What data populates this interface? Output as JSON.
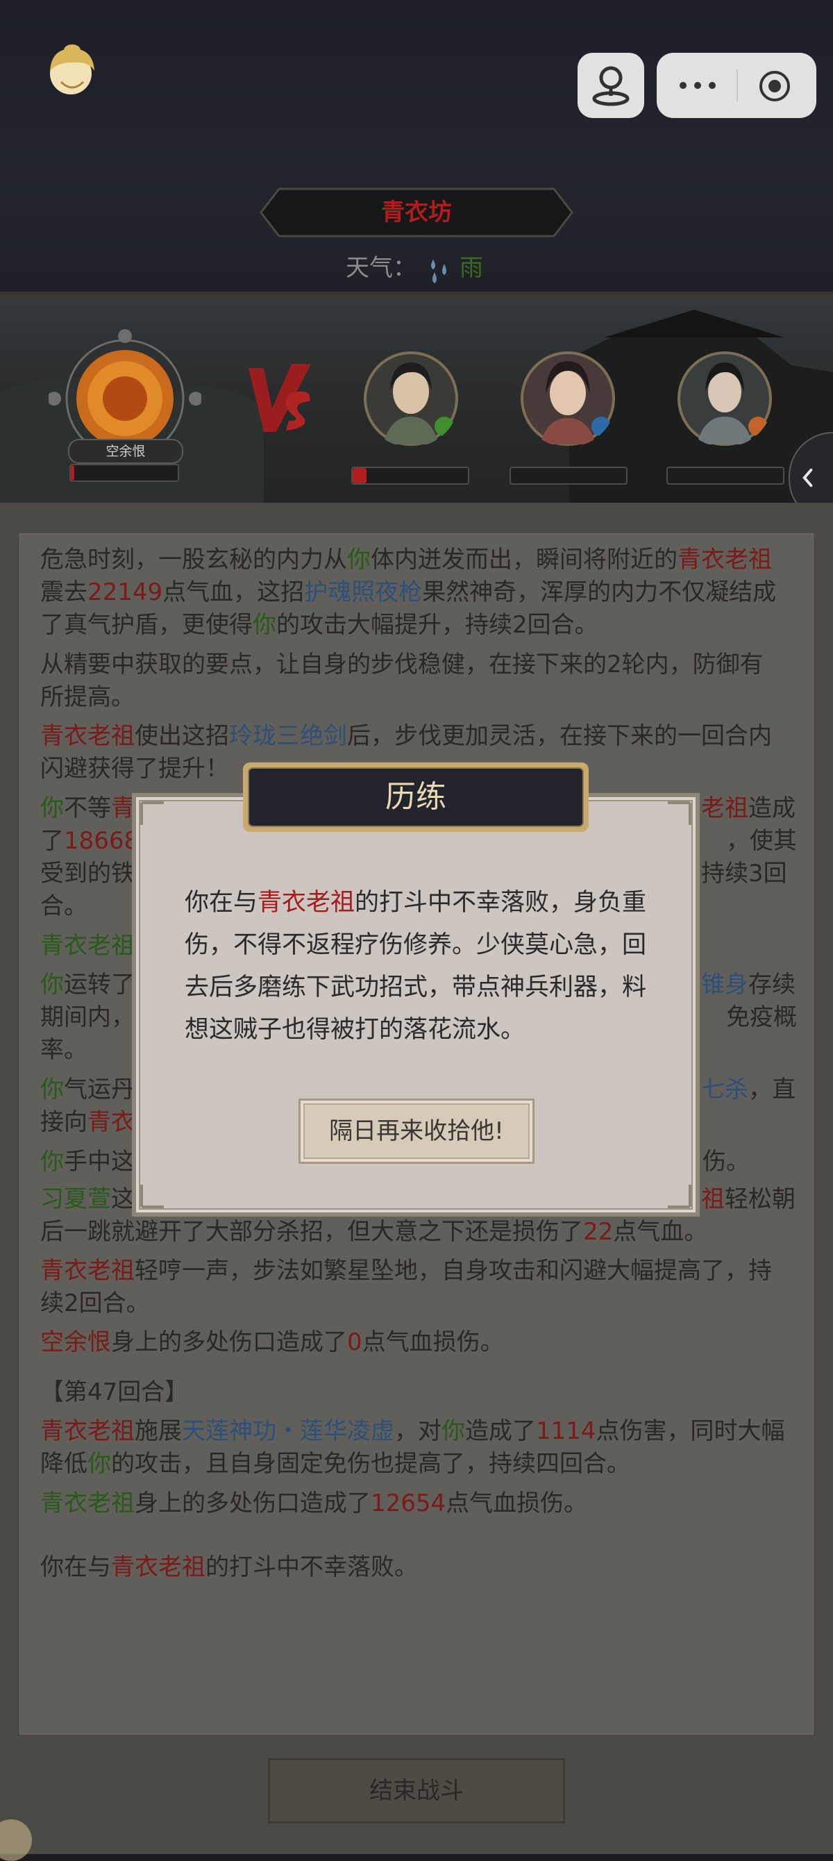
{
  "header": {
    "location": "青衣坊",
    "weather_label": "天气：",
    "weather_icon": "rain-drops-icon",
    "weather_value": "雨"
  },
  "battle": {
    "player_name": "空余恨",
    "vs_text": "VS",
    "player_hp": 0.03,
    "enemies": [
      {
        "hp": 0.12,
        "badge_color": "#3f8f2e"
      },
      {
        "hp": 0.0,
        "badge_color": "#2c6aa8"
      },
      {
        "hp": 0.0,
        "badge_color": "#c2642a"
      }
    ]
  },
  "log": {
    "l1": [
      [
        "危急时刻，一股玄秘的内力从",
        ""
      ],
      [
        "你",
        "g"
      ],
      [
        "体内迸发而出，瞬间将附近的",
        ""
      ],
      [
        "青衣老祖",
        "r"
      ]
    ],
    "l2": [
      [
        "震去",
        ""
      ],
      [
        "22149",
        "r"
      ],
      [
        "点气血，这招",
        ""
      ],
      [
        "护魂照夜枪",
        "b"
      ],
      [
        "果然神奇，浑厚的内力不仅凝结成",
        ""
      ]
    ],
    "l3": [
      [
        "了真气护盾，更使得",
        ""
      ],
      [
        "你",
        "g"
      ],
      [
        "的攻击大幅提升，持续2回合。",
        ""
      ]
    ],
    "l4": [
      [
        "从精要中获取的要点，让自身的步伐稳健，在接下来的2轮内，防御有",
        ""
      ]
    ],
    "l5": [
      [
        "所提高。",
        ""
      ]
    ],
    "l6": [
      [
        "青衣老祖",
        "r"
      ],
      [
        "使出这招",
        ""
      ],
      [
        "玲珑三绝剑",
        "b"
      ],
      [
        "后，步伐更加灵活，在接下来的一回合内",
        ""
      ]
    ],
    "l7": [
      [
        "闪避获得了提升！",
        ""
      ]
    ],
    "l8": [
      [
        "你",
        "g"
      ],
      [
        "不等",
        ""
      ],
      [
        "青",
        "r"
      ]
    ],
    "l8b": [
      [
        "老祖",
        "r"
      ],
      [
        "造成",
        ""
      ]
    ],
    "l9": [
      [
        "了",
        ""
      ],
      [
        "18668",
        "r"
      ]
    ],
    "l9b": [
      [
        "，使其",
        ""
      ]
    ],
    "l10": [
      [
        "受到的铁",
        ""
      ]
    ],
    "l10b": [
      [
        "持续3回",
        ""
      ]
    ],
    "l11": [
      [
        "合。",
        ""
      ]
    ],
    "l12": [
      [
        "青衣老祖",
        "g"
      ]
    ],
    "l13": [
      [
        "你",
        "g"
      ],
      [
        "运转了",
        ""
      ]
    ],
    "l13b": [
      [
        "锥身",
        "b"
      ],
      [
        "存续",
        ""
      ]
    ],
    "l14": [
      [
        "期间内，",
        ""
      ]
    ],
    "l14b": [
      [
        "免疫概",
        ""
      ]
    ],
    "l15": [
      [
        "率。",
        ""
      ]
    ],
    "l16": [
      [
        "你",
        "g"
      ],
      [
        "气运丹",
        ""
      ]
    ],
    "l16b": [
      [
        "七杀",
        "b"
      ],
      [
        "，直",
        ""
      ]
    ],
    "l17": [
      [
        "接向",
        ""
      ],
      [
        "青衣",
        "r"
      ]
    ],
    "l18": [
      [
        "你",
        "g"
      ],
      [
        "手中这",
        ""
      ]
    ],
    "l18b": [
      [
        "伤。",
        ""
      ]
    ],
    "l19": [
      [
        "习夏萱",
        "g"
      ],
      [
        "这",
        ""
      ]
    ],
    "l19b": [
      [
        "祖",
        "r"
      ],
      [
        "轻松朝",
        ""
      ]
    ],
    "l20": [
      [
        "后一跳就避开了大部分杀招，但大意之下还是损伤了",
        ""
      ],
      [
        "22",
        "r"
      ],
      [
        "点气血。",
        ""
      ]
    ],
    "l21": [
      [
        "青衣老祖",
        "r"
      ],
      [
        "轻哼一声，步法如繁星坠地，自身攻击和闪避大幅提高了，持",
        ""
      ]
    ],
    "l22": [
      [
        "续2回合。",
        ""
      ]
    ],
    "l23": [
      [
        "空余恨",
        "r"
      ],
      [
        "身上的多处伤口造成了",
        ""
      ],
      [
        "0",
        "r"
      ],
      [
        "点气血损伤。",
        ""
      ]
    ],
    "l24": [
      [
        "【第47回合】",
        ""
      ]
    ],
    "l25": [
      [
        "青衣老祖",
        "r"
      ],
      [
        "施展",
        ""
      ],
      [
        "天莲神功・莲华凌虚",
        "b"
      ],
      [
        "，对",
        ""
      ],
      [
        "你",
        "g"
      ],
      [
        "造成了",
        ""
      ],
      [
        "1114",
        "r"
      ],
      [
        "点伤害，同时大幅",
        ""
      ]
    ],
    "l26": [
      [
        "降低",
        ""
      ],
      [
        "你",
        "g"
      ],
      [
        "的攻击，且自身固定免伤也提高了，持续四回合。",
        ""
      ]
    ],
    "l27": [
      [
        "青衣老祖",
        "g"
      ],
      [
        "身上的多处伤口造成了",
        ""
      ],
      [
        "12654",
        "r"
      ],
      [
        "点气血损伤。",
        ""
      ]
    ],
    "l28": [
      [
        "你在与",
        ""
      ],
      [
        "青衣老祖",
        "r"
      ],
      [
        "的打斗中不幸落败。",
        ""
      ]
    ]
  },
  "end_button": "结束战斗",
  "modal": {
    "title": "历练",
    "body_1a": "你在与",
    "body_1b": "青衣老祖",
    "body_1c": "的打斗中不幸落败，身负重",
    "body_2": "伤，不得不返程疗伤修养。少侠莫心急，回",
    "body_3": "去后多磨练下武功招式，带点神兵利器，料",
    "body_4": "想这贼子也得被打的落花流水。",
    "button": "隔日再来收拾他!"
  }
}
